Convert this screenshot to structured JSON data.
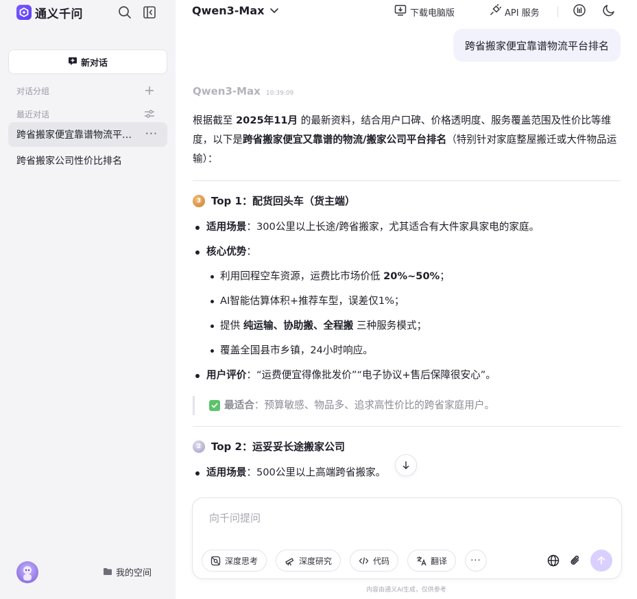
{
  "brand": {
    "name": "通义千问"
  },
  "sidebar": {
    "new_chat_label": "新对话",
    "groups_label": "对话分组",
    "recent_label": "最近对话",
    "conversations": [
      {
        "label": "跨省搬家便宜靠谱物流平台排名",
        "active": true
      },
      {
        "label": "跨省搬家公司性价比排名",
        "active": false
      }
    ],
    "my_space_label": "我的空间"
  },
  "header": {
    "model_name": "Qwen3-Max",
    "download_label": "下载电脑版",
    "api_label": "API 服务"
  },
  "chat": {
    "user_message": "跨省搬家便宜靠谱物流平台排名",
    "answer_model": "Qwen3-Max",
    "answer_time": "10:39:09",
    "intro": {
      "p1": "根据截至 ",
      "p1_bold": "2025年11月",
      "p2": " 的最新资料，结合用户口碑、价格透明度、服务覆盖范围及性价比等维度，以下是",
      "p2_bold": "跨省搬家便宜又靠谱的物流/搬家公司平台排名",
      "p3": "（特别针对家庭整屋搬迁或大件物品运输）："
    },
    "top1": {
      "title": "Top 1：配货回头车（货主端）",
      "scene_label": "适用场景",
      "scene_text": "：300公里以上长途/跨省搬家，尤其适合有大件家具家电的家庭。",
      "adv_label": "核心优势",
      "adv_colon": "：",
      "adv1_pre": "利用回程空车资源，运费比市场价低 ",
      "adv1_bold": "20%~50%",
      "adv1_post": "；",
      "adv2": "AI智能估算体积+推荐车型，误差仅1%；",
      "adv3_pre": "提供 ",
      "adv3_bold": "纯运输、协助搬、全程搬",
      "adv3_post": " 三种服务模式；",
      "adv4": "覆盖全国县市乡镇，24小时响应。",
      "review_label": "用户评价",
      "review_text": "：“运费便宜得像批发价”“电子协议+售后保障很安心”。",
      "fit_label": "最适合",
      "fit_text": "：预算敏感、物品多、追求高性价比的跨省家庭用户。"
    },
    "top2": {
      "title": "Top 2：运妥妥长途搬家公司",
      "scene_label": "适用场景",
      "scene_text": "：500公里以上高端跨省搬家。"
    }
  },
  "composer": {
    "placeholder": "向千问提问",
    "chips": [
      "深度思考",
      "深度研究",
      "代码",
      "翻译"
    ],
    "more": "···"
  },
  "footer": {
    "disclaimer": "内容由通义AI生成，仅供参考"
  },
  "colors": {
    "accent": "#6b4cf6",
    "send_bg": "#d9d0ff"
  }
}
